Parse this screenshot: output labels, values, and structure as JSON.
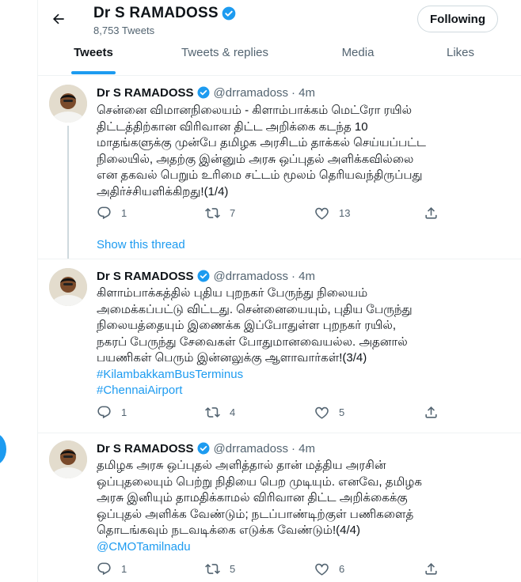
{
  "header": {
    "title": "Dr S RAMADOSS",
    "tweet_count": "8,753 Tweets",
    "following_label": "Following",
    "back_icon": "arrow-left-icon",
    "verified_icon": "verified-badge-icon"
  },
  "tabs": [
    {
      "label": "Tweets",
      "active": true
    },
    {
      "label": "Tweets & replies",
      "active": false
    },
    {
      "label": "Media",
      "active": false
    },
    {
      "label": "Likes",
      "active": false
    }
  ],
  "colors": {
    "accent": "#1d9bf0",
    "text": "#0f1419",
    "muted": "#536471"
  },
  "tweets": [
    {
      "name": "Dr S RAMADOSS",
      "handle": "@drramadoss",
      "time": "· 4m",
      "lines": [
        "சென்னை விமானநிலையம் - கிளாம்பாக்கம் மெட்ரோ ரயில்",
        "திட்டத்திற்கான விரிவான திட்ட அறிக்கை கடந்த 10",
        "மாதங்களுக்கு முன்பே தமிழக அரசிடம் தாக்கல் செய்யப்பட்ட",
        "நிலையில், அதற்கு இன்னும் அரசு ஒப்புதல் அளிக்கவில்லை",
        "என தகவல் பெறும் உரிமை சட்டம் மூலம் தெரியவந்திருப்பது",
        "அதிர்ச்சியளிக்கிறது!(1/4)"
      ],
      "links": [],
      "replies": "1",
      "retweets": "7",
      "likes": "13",
      "show_thread": "Show this thread"
    },
    {
      "name": "Dr S RAMADOSS",
      "handle": "@drramadoss",
      "time": "· 4m",
      "lines": [
        "கிளாம்பாக்கத்தில் புதிய புறநகர் பேருந்து நிலையம்",
        "அமைக்கப்பட்டு விட்டது. சென்னையையும், புதிய பேருந்து",
        "நிலையத்தையும் இணைக்க இப்போதுள்ள புறநகர் ரயில்,",
        "நகரப் பேருந்து சேவைகள்  போதுமானவையல்ல. அதனால்",
        "பயணிகள் பெரும் இன்னலுக்கு ஆளாவார்கள்!(3/4)"
      ],
      "links": [
        "#KilambakkamBusTerminus",
        "#ChennaiAirport"
      ],
      "replies": "1",
      "retweets": "4",
      "likes": "5"
    },
    {
      "name": "Dr S RAMADOSS",
      "handle": "@drramadoss",
      "time": "· 4m",
      "lines": [
        "தமிழக அரசு ஒப்புதல் அளித்தால் தான் மத்திய அரசின்",
        "ஒப்புதலையும் பெற்று நிதியை பெற முடியும். எனவே, தமிழக",
        "அரசு இனியும் தாமதிக்காமல் விரிவான திட்ட அறிக்கைக்கு",
        "ஒப்புதல் அளிக்க வேண்டும்; நடப்பாண்டிற்குள் பணிகளைத்",
        "தொடங்கவும் நடவடிக்கை எடுக்க வேண்டும்!(4/4)"
      ],
      "links": [
        "@CMOTamilnadu"
      ],
      "replies": "1",
      "retweets": "5",
      "likes": "6"
    }
  ]
}
